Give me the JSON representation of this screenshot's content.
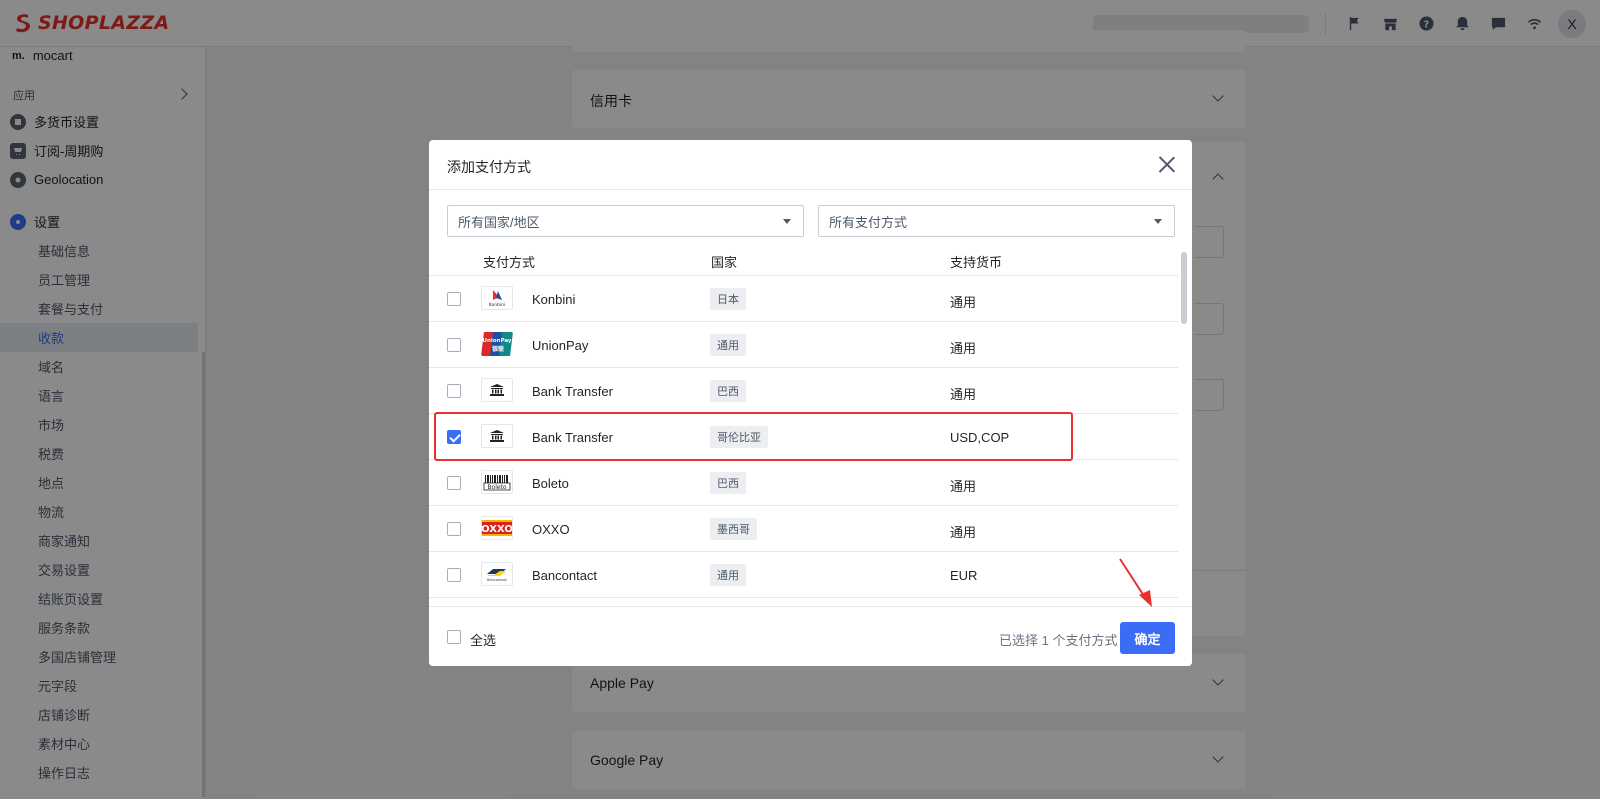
{
  "brand": {
    "logo_text": "SHOPLAZZA",
    "logo_color": "#e8302a"
  },
  "topbar": {
    "icons": [
      "flag-icon",
      "store-icon",
      "help-icon",
      "bell-icon",
      "chat-icon",
      "wifi-icon"
    ],
    "avatar_initial": "X"
  },
  "sidebar": {
    "partial_top_item": "mocart",
    "apps_group": "应用",
    "apps": [
      {
        "label": "多货币设置",
        "icon": "currency-icon"
      },
      {
        "label": "订阅-周期购",
        "icon": "subscription-icon"
      },
      {
        "label": "Geolocation",
        "icon": "geolocation-icon"
      }
    ],
    "settings_label": "设置",
    "settings_items": [
      "基础信息",
      "员工管理",
      "套餐与支付",
      "收款",
      "域名",
      "语言",
      "市场",
      "税费",
      "地点",
      "物流",
      "商家通知",
      "交易设置",
      "结账页设置",
      "服务条款",
      "多国店铺管理",
      "元字段",
      "店铺诊断",
      "素材中心",
      "操作日志"
    ],
    "active_item": "收款"
  },
  "main": {
    "cards": {
      "credit_card": "信用卡",
      "apple_pay": "Apple Pay",
      "google_pay": "Google Pay"
    }
  },
  "modal": {
    "title": "添加支付方式",
    "filter_country": "所有国家/地区",
    "filter_method": "所有支付方式",
    "columns": {
      "method": "支付方式",
      "country": "国家",
      "currency": "支持货币"
    },
    "rows": [
      {
        "name": "Konbini",
        "country": "日本",
        "currency": "通用",
        "checked": false,
        "logo": "konbini-logo"
      },
      {
        "name": "UnionPay",
        "country": "通用",
        "currency": "通用",
        "checked": false,
        "logo": "unionpay-logo"
      },
      {
        "name": "Bank Transfer",
        "country": "巴西",
        "currency": "通用",
        "checked": false,
        "logo": "bank-icon"
      },
      {
        "name": "Bank Transfer",
        "country": "哥伦比亚",
        "currency": "USD,COP",
        "checked": true,
        "logo": "bank-icon"
      },
      {
        "name": "Boleto",
        "country": "巴西",
        "currency": "通用",
        "checked": false,
        "logo": "boleto-logo"
      },
      {
        "name": "OXXO",
        "country": "墨西哥",
        "currency": "通用",
        "checked": false,
        "logo": "oxxo-logo"
      },
      {
        "name": "Bancontact",
        "country": "通用",
        "currency": "EUR",
        "checked": false,
        "logo": "bancontact-logo"
      }
    ],
    "select_all": "全选",
    "selected_count_text": "已选择 1 个支付方式",
    "confirm": "确定",
    "accent_color": "#3b6cf5"
  },
  "annotation": {
    "highlight_color": "#e8312f"
  }
}
